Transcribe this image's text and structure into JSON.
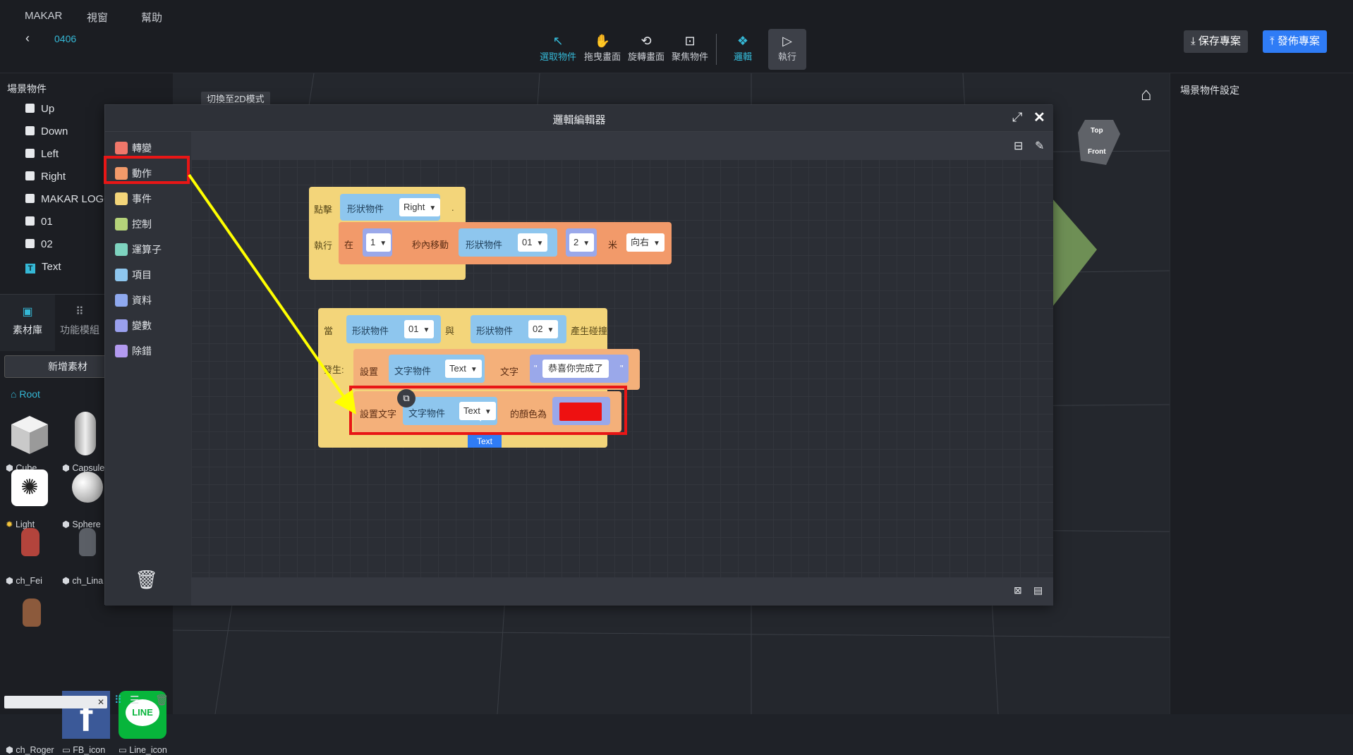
{
  "menu": [
    "MAKAR",
    "視窗",
    "幫助"
  ],
  "project": {
    "name": "0406"
  },
  "toolbar": {
    "tools": [
      {
        "label": "選取物件",
        "icon": "cursor-icon",
        "active": true
      },
      {
        "label": "拖曳畫面",
        "icon": "hand-icon",
        "active": false
      },
      {
        "label": "旋轉畫面",
        "icon": "rotate-view-icon",
        "active": false
      },
      {
        "label": "聚焦物件",
        "icon": "focus-icon",
        "active": false
      },
      {
        "label": "邏輯",
        "icon": "logic-icon",
        "active": true
      },
      {
        "label": "執行",
        "icon": "play-icon",
        "active": false
      }
    ],
    "save": "保存專案",
    "publish": "發佈專案"
  },
  "scene_objects": {
    "title": "場景物件",
    "items": [
      "Up",
      "Down",
      "Left",
      "Right",
      "MAKAR LOGO",
      "01",
      "02",
      "Text"
    ]
  },
  "left_tabs": {
    "assets": "素材庫",
    "modules": "功能模組"
  },
  "add_asset": "新增素材",
  "root": "Root",
  "assets": [
    "Cube",
    "Capsule",
    "Light",
    "Sphere",
    "ch_Fei",
    "ch_Lina",
    "ch_Roger",
    "FB_icon",
    "Line_icon"
  ],
  "viewport": {
    "switch_2d": "切換至2D模式",
    "cube_top": "Top",
    "cube_front": "Front"
  },
  "right_panel": {
    "title": "場景物件設定"
  },
  "logic_editor": {
    "title": "邏輯編輯器",
    "categories": [
      {
        "label": "轉變",
        "color": "#f0776a"
      },
      {
        "label": "動作",
        "color": "#f29a6a"
      },
      {
        "label": "事件",
        "color": "#f3d57a"
      },
      {
        "label": "控制",
        "color": "#b5d37a"
      },
      {
        "label": "運算子",
        "color": "#7ed3bf"
      },
      {
        "label": "項目",
        "color": "#8ec6ee"
      },
      {
        "label": "資料",
        "color": "#8fa9ef"
      },
      {
        "label": "變數",
        "color": "#9aa0ee"
      },
      {
        "label": "除錯",
        "color": "#b39af0"
      }
    ],
    "block1": {
      "click": "點擊",
      "shape_obj": "形狀物件",
      "target": "Right",
      "dot": ".",
      "exec": "執行",
      "in": "在",
      "seconds": "1",
      "sec_move": "秒內移動",
      "shape_obj2": "形狀物件",
      "obj": "01",
      "dist": "2",
      "meter": "米",
      "direction": "向右"
    },
    "block2": {
      "when": "當",
      "shape_obj": "形狀物件",
      "obj1": "01",
      "and": "與",
      "shape_obj2": "形狀物件",
      "obj2": "02",
      "collide": "產生碰撞",
      "happen": "發生:",
      "set": "設置",
      "text_obj": "文字物件",
      "text_target": "Text",
      "text_label": "文字",
      "quote_open": "\"",
      "message": "恭喜你完成了",
      "quote_close": "\"",
      "set_text": "設置文字",
      "text_obj2": "文字物件",
      "text_target2": "Text",
      "color_to": "的顏色為",
      "color": "#ee1111"
    },
    "tooltip": "Text"
  }
}
